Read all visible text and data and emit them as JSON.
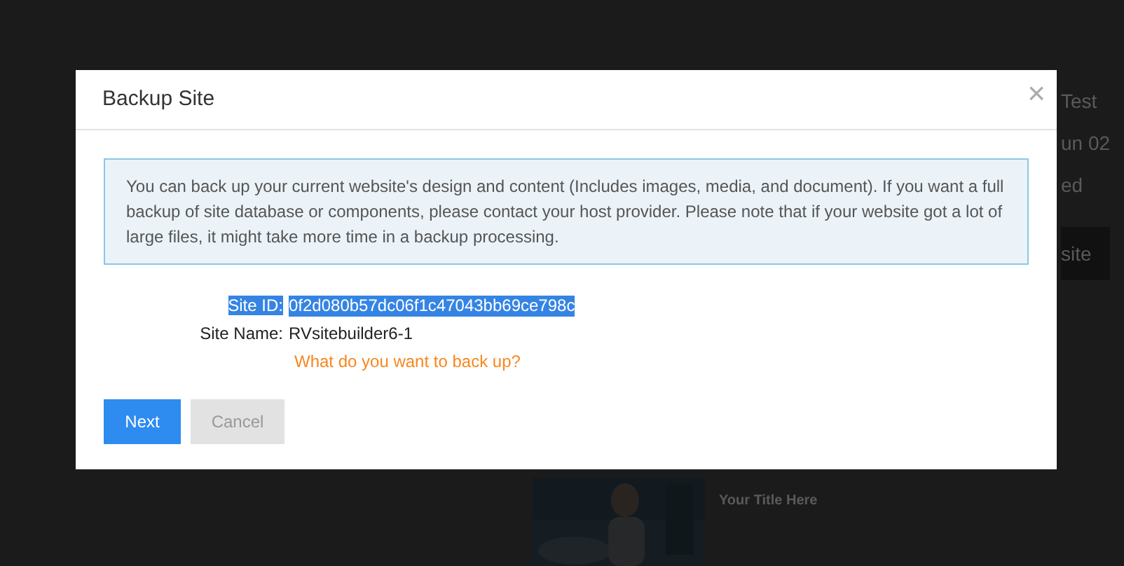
{
  "background": {
    "side_texts": [
      "Test",
      "un 02",
      "ed"
    ],
    "side_button": "site",
    "card_title": "Your Title Here"
  },
  "dialog": {
    "title": "Backup Site",
    "close": "×",
    "notice": "You can back up your current website's design and content (Includes images, media, and document). If you want a full backup of site database or components, please contact your host provider. Please note that if your website got a lot of large files, it might take more time in a backup processing.",
    "fields": [
      {
        "label": "Site ID:",
        "value": "0f2d080b57dc06f1c47043bb69ce798c",
        "highlighted": true
      },
      {
        "label": "Site Name:",
        "value": "RVsitebuilder6-1",
        "highlighted": false
      }
    ],
    "question": "What do you want to back up?",
    "buttons": [
      {
        "label": "Next",
        "kind": "primary"
      },
      {
        "label": "Cancel",
        "kind": "secondary"
      }
    ]
  }
}
